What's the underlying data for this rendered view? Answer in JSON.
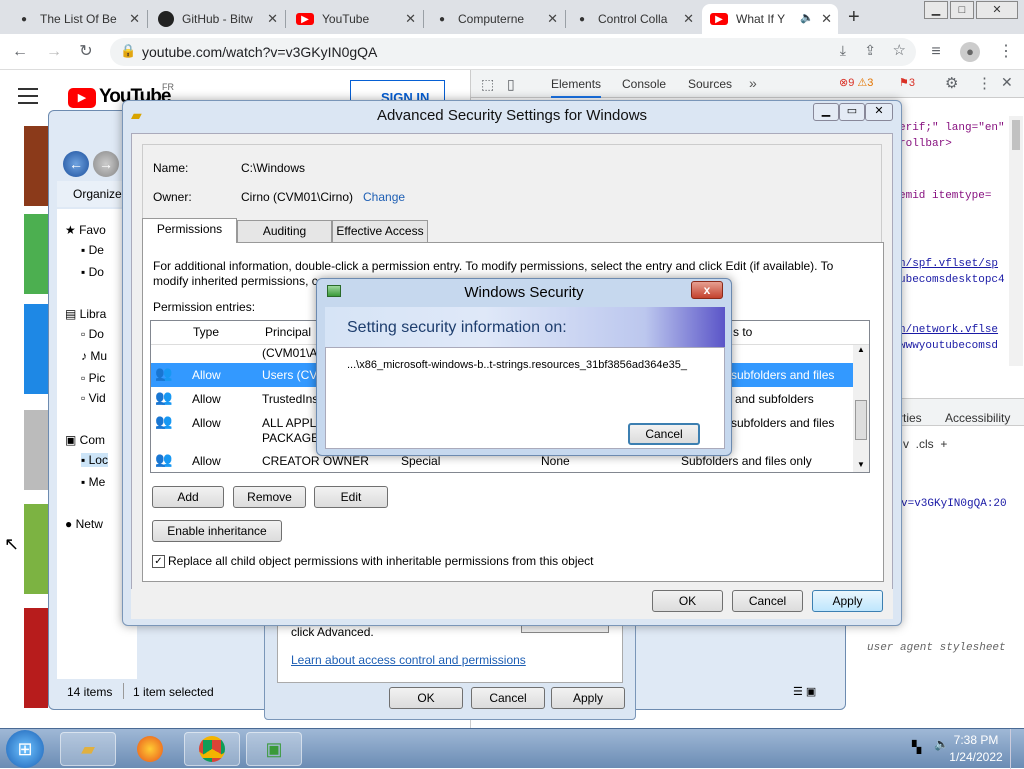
{
  "browser": {
    "tabs": [
      {
        "label": "The List Of Be",
        "icon": "user-icon"
      },
      {
        "label": "GitHub - Bitw",
        "icon": "github-icon"
      },
      {
        "label": "YouTube",
        "icon": "youtube-icon"
      },
      {
        "label": "Computerne",
        "icon": "user-icon"
      },
      {
        "label": "Control Colla",
        "icon": "user-icon"
      },
      {
        "label": "What If Y",
        "icon": "youtube-icon"
      }
    ],
    "new_tab": "+",
    "url": "youtube.com/watch?v=v3GKyIN0gQA"
  },
  "youtube": {
    "logo": "YouTube",
    "region": "FR",
    "sign_in": "SIGN IN"
  },
  "devtools": {
    "tabs": [
      "Elements",
      "Console",
      "Sources"
    ],
    "more": "»",
    "errors": "9",
    "warnings": "3",
    "issues": "3",
    "code_lines": [
      "erif;\" lang=\"en\"",
      "rollbar>",
      "emid itemtype=",
      "n/spf.vflset/sp",
      "ubecomsdesktopc4",
      "n/network.vflse",
      "wwwyoutubecomsd",
      "v=v3GKyIN0gQA:20"
    ],
    "styles_tabs": [
      "rties",
      "Accessibility"
    ],
    "style_filter": "v  .cls  +",
    "user_agent": "user agent stylesheet"
  },
  "explorer": {
    "organize": "Organize",
    "nav_items": [
      "Favo",
      "De",
      "Do",
      "Libra",
      "Do",
      "Mu",
      "Pic",
      "Vid",
      "Com",
      "Loc",
      "Me",
      "Netw"
    ],
    "status_items": "14 items",
    "status_selected": "1 item selected"
  },
  "props_behind": {
    "text": "click Advanced.",
    "link": "Learn about access control and permissions",
    "ok": "OK",
    "cancel": "Cancel",
    "apply": "Apply"
  },
  "advanced": {
    "title": "Advanced Security Settings for Windows",
    "name_label": "Name:",
    "name_value": "C:\\Windows",
    "owner_label": "Owner:",
    "owner_value": "Cirno (CVM01\\Cirno)",
    "owner_change": "Change",
    "tabs": [
      "Permissions",
      "Auditing",
      "Effective Access"
    ],
    "info": "For additional information, double-click a permission entry. To modify permissions, select the entry and click Edit (if available). To modify inherited permissions, c",
    "entries_label": "Permission entries:",
    "columns": [
      "Type",
      "Principal",
      "s to"
    ],
    "rows": [
      {
        "type": "",
        "principal": "(CVM01\\A",
        "applies": ""
      },
      {
        "type": "Allow",
        "principal": "Users (CV",
        "applies": "r, subfolders and files"
      },
      {
        "type": "Allow",
        "principal": "TrustedIns",
        "applies": "er and subfolders"
      },
      {
        "type": "Allow",
        "principal": "ALL APPLI",
        "principal2": "PACKAGES",
        "applies": "r, subfolders and files"
      },
      {
        "type": "Allow",
        "principal": "CREATOR OWNER",
        "access": "Special",
        "inherited": "None",
        "applies": "Subfolders and files only"
      }
    ],
    "add": "Add",
    "remove": "Remove",
    "edit": "Edit",
    "enable_inheritance": "Enable inheritance",
    "replace_check": "Replace all child object permissions with inheritable permissions from this object",
    "ok": "OK",
    "cancel": "Cancel",
    "apply": "Apply"
  },
  "winsec": {
    "title": "Windows Security",
    "close": "x",
    "heading": "Setting security information on:",
    "path": "...\\x86_microsoft-windows-b..t-strings.resources_31bf3856ad364e35_",
    "cancel": "Cancel"
  },
  "taskbar": {
    "time": "7:38 PM",
    "date": "1/24/2022"
  }
}
